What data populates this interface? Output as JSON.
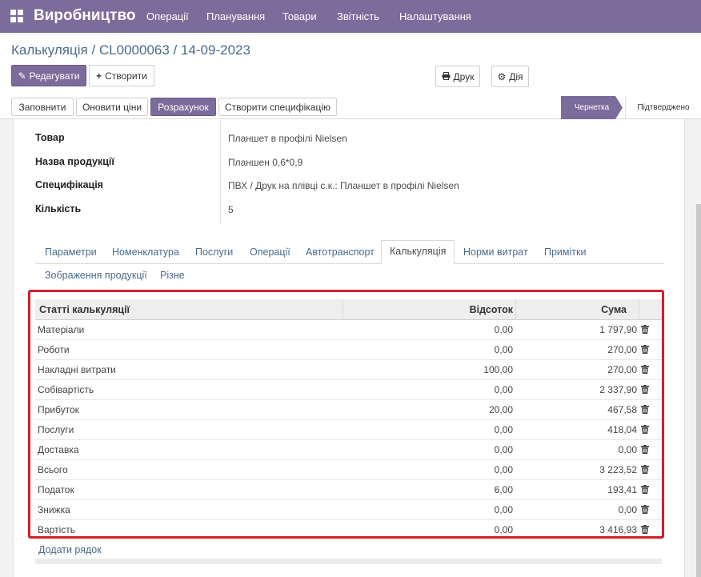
{
  "topbar": {
    "brand": "Виробництво",
    "menu": [
      "Операції",
      "Планування",
      "Товари",
      "Звітність",
      "Налаштування"
    ]
  },
  "breadcrumb": "Калькуляція / CL0000063 / 14-09-2023",
  "buttons": {
    "edit": "Редагувати",
    "create": "Створити",
    "print": "Друк",
    "action": "Дія"
  },
  "actions": {
    "fill": "Заповнити",
    "update_prices": "Оновити ціни",
    "calculate": "Розрахунок",
    "create_spec": "Створити специфікацію"
  },
  "status": {
    "draft": "Чернетка",
    "confirmed": "Підтверджено"
  },
  "fields": {
    "product_label": "Товар",
    "product_value": "Планшет в профілі Nielsen",
    "name_label": "Назва продукції",
    "name_value": "Планшен 0,6*0,9",
    "spec_label": "Специфікація",
    "spec_value": "ПВХ / Друк на плівці с.к.: Планшет в профілі Nielsen",
    "qty_label": "Кількість",
    "qty_value": "5"
  },
  "tabs": {
    "params": "Параметри",
    "nomenclature": "Номенклатура",
    "services": "Послуги",
    "operations": "Операції",
    "transport": "Автотранспорт",
    "calculation": "Калькуляція",
    "norms": "Норми витрат",
    "notes": "Примітки",
    "images": "Зображення продукції",
    "misc": "Різне"
  },
  "table": {
    "headers": {
      "item": "Статті калькуляції",
      "percent": "Відсоток",
      "sum": "Сума"
    },
    "rows": [
      {
        "name": "Матеріали",
        "percent": "0,00",
        "sum": "1 797,90"
      },
      {
        "name": "Роботи",
        "percent": "0,00",
        "sum": "270,00"
      },
      {
        "name": "Накладні витрати",
        "percent": "100,00",
        "sum": "270,00"
      },
      {
        "name": "Собівартість",
        "percent": "0,00",
        "sum": "2 337,90"
      },
      {
        "name": "Прибуток",
        "percent": "20,00",
        "sum": "467,58"
      },
      {
        "name": "Послуги",
        "percent": "0,00",
        "sum": "418,04"
      },
      {
        "name": "Доставка",
        "percent": "0,00",
        "sum": "0,00"
      },
      {
        "name": "Всього",
        "percent": "0,00",
        "sum": "3 223,52"
      },
      {
        "name": "Податок",
        "percent": "6,00",
        "sum": "193,41"
      },
      {
        "name": "Знижка",
        "percent": "0,00",
        "sum": "0,00"
      },
      {
        "name": "Вартість",
        "percent": "0,00",
        "sum": "3 416,93"
      }
    ],
    "add_row": "Додати рядок"
  },
  "colors": {
    "brand": "#7c6c9b",
    "highlight": "#d0202a",
    "link": "#4a6a8a"
  }
}
